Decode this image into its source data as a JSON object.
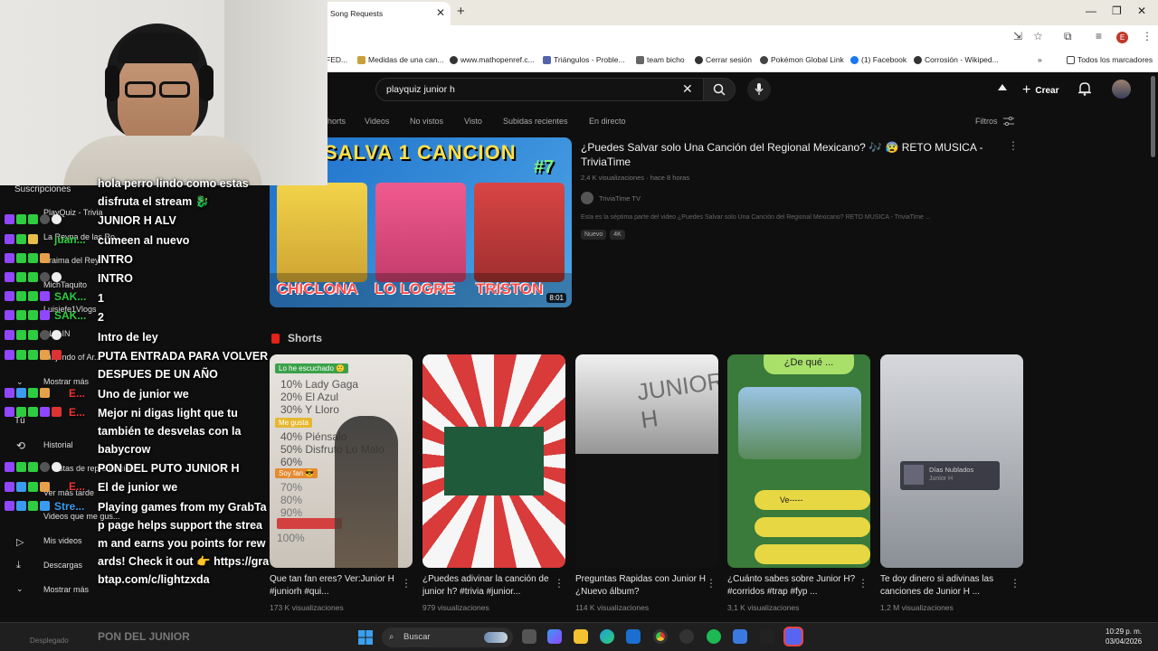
{
  "browser": {
    "tab_title": "Song Requests",
    "bookmarks": [
      "FED...",
      "Medidas de una can...",
      "www.mathopenref.c...",
      "Triángulos - Proble...",
      "team bicho",
      "Cerrar sesión",
      "Pokémon Global Link",
      "(1) Facebook",
      "Corrosión - Wikiped..."
    ],
    "all_bookmarks": "Todos los marcadores",
    "profile_letter": "E"
  },
  "youtube": {
    "search_query": "playquiz junior h",
    "create_label": "Crear",
    "chips": [
      "Shorts",
      "Videos",
      "No vistos",
      "Visto",
      "Subidas recientes",
      "En directo"
    ],
    "filters_label": "Filtros",
    "featured": {
      "title": "¿Puedes Salvar solo Una Canción del Regional Mexicano? 🎶 😰 RETO MUSICA - TriviaTime",
      "meta": "2,4 K visualizaciones · hace 8 horas",
      "channel": "TriviaTime TV",
      "description": "Esta es la séptima parte del video ¿Puedes Salvar solo Una Canción del Regional Mexicano? RETO MUSICA - TriviaTime ...",
      "tags": [
        "Nuevo",
        "4K"
      ],
      "thumb_title": "SALVA 1 CANCION",
      "thumb_badge": "#7",
      "thumb_names": [
        "CHICLONA",
        "LO LOGRE",
        "TRISTON"
      ],
      "duration": "8:01"
    },
    "shorts_label": "Shorts",
    "shorts": [
      {
        "title": "Que tan fan eres? Ver:Junior H #juniorh #qui...",
        "views": "173 K visualizaciones"
      },
      {
        "title": "¿Puedes adivinar la canción de junior h? #trivia #junior...",
        "views": "979 visualizaciones"
      },
      {
        "title": "Preguntas Rapidas con Junior H ¿Nuevo álbum?",
        "views": "114 K visualizaciones"
      },
      {
        "title": "¿Cuánto sabes sobre Junior H? #corridos #trap #fyp ...",
        "views": "3,1 K visualizaciones"
      },
      {
        "title": "Te doy dinero si adivinas las canciones de Junior H ...",
        "views": "1,2 M visualizaciones"
      }
    ],
    "short1_overlay": {
      "heard": "Lo he escuchado 🙂",
      "lines": [
        "10% Lady Gaga",
        "20% El Azul",
        "30% Y Lloro"
      ],
      "likes": "Me gusta",
      "lines2": [
        "40% Piénsalo",
        "50% Disfruto Lo Malo",
        "60%"
      ],
      "fan": "Soy fan 😎",
      "lines3": [
        "70%",
        "80%",
        "90%"
      ],
      "last": "100%"
    },
    "short3_overlay": "JUNIOR H",
    "short4_overlay": "¿De qué ...",
    "short4_overlay2": "Ve-----",
    "short5_overlay": {
      "title": "Días Nublados",
      "artist": "Junior H"
    },
    "sidebar": {
      "subscriptions": "Suscripciones",
      "channels": [
        "PlayQuiz - Trivia",
        "La Reyna de las Ro...",
        "Braima del Rey",
        "MichTaquito",
        "Luisiefe1Vlogs",
        "DLC IN",
        "Ninjendo of Ar..."
      ],
      "show_more": "Mostrar más",
      "you": "Tú",
      "history": "Historial",
      "reproduction": "Listas de reproducción",
      "watch_later": "Ver más tarde",
      "liked": "Videos que me gus...",
      "my_videos": "Mis videos",
      "downloads": "Descargas",
      "show_more2": "Mostrar más"
    }
  },
  "chat": {
    "messages": [
      {
        "text": "hola perro lindo como estas disfruta el stream 🐉",
        "user": ""
      },
      {
        "text": "JUNIOR H ALV",
        "user": ""
      },
      {
        "text": "cumeen al nuevo",
        "user": "juan..."
      },
      {
        "text": "INTRO",
        "user": ""
      },
      {
        "text": "INTRO",
        "user": ""
      },
      {
        "text": "1",
        "user": "SAK..."
      },
      {
        "text": "2",
        "user": "SAK..."
      },
      {
        "text": "Intro de ley",
        "user": ""
      },
      {
        "text": "PUTA ENTRADA PARA VOLVER DESPUES DE UN AÑO",
        "user": ""
      },
      {
        "text": "Uno de junior we",
        "user": "E..."
      },
      {
        "text": "Mejor ni digas light que tu también te desvelas con la babycrow",
        "user": "E..."
      },
      {
        "text": "PON DEL PUTO JUNIOR H",
        "user": ""
      },
      {
        "text": "El de junior we",
        "user": "E..."
      },
      {
        "text": "Playing games from my GrabTap page helps support the stream and earns you points for rewards! Check it out 👉 https://grabtap.com/c/lightzxda",
        "user": "Stre..."
      },
      {
        "text": "PON DEL JUNIOR",
        "user": ""
      }
    ],
    "desplegado": "Desplegado"
  },
  "taskbar": {
    "search": "Buscar",
    "time": "10:29 p. m.",
    "date": "03/04/2026"
  }
}
